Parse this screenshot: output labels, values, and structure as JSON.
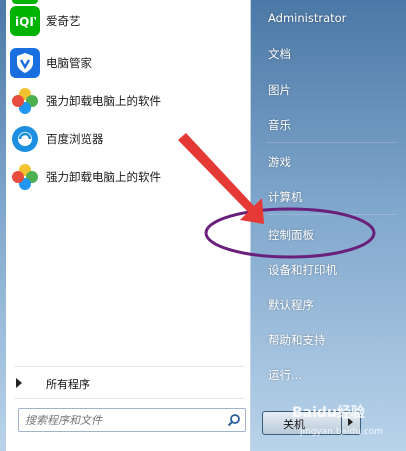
{
  "programs": [
    {
      "label": "爱奇艺",
      "icon": "iqiyi-icon",
      "color": "#00b300"
    },
    {
      "label": "电脑管家",
      "icon": "shield-icon",
      "color": "#1a6fe0"
    },
    {
      "label": "强力卸载电脑上的软件",
      "icon": "pinwheel-icon",
      "color": "#e84c3d"
    },
    {
      "label": "百度浏览器",
      "icon": "browser-icon",
      "color": "#1c8fe0"
    },
    {
      "label": "强力卸载电脑上的软件",
      "icon": "pinwheel-icon",
      "color": "#e84c3d"
    }
  ],
  "all_programs": "所有程序",
  "search": {
    "placeholder": "搜索程序和文件"
  },
  "right_menu": [
    "Administrator",
    "文档",
    "图片",
    "音乐",
    "游戏",
    "计算机",
    "控制面板",
    "设备和打印机",
    "默认程序",
    "帮助和支持",
    "运行..."
  ],
  "shutdown_label": "关机",
  "watermark": {
    "brand": "Baidu经验",
    "url": "jingyan.baidu.com"
  },
  "highlight_color": "#6a1f7a",
  "arrow_color": "#e53935"
}
